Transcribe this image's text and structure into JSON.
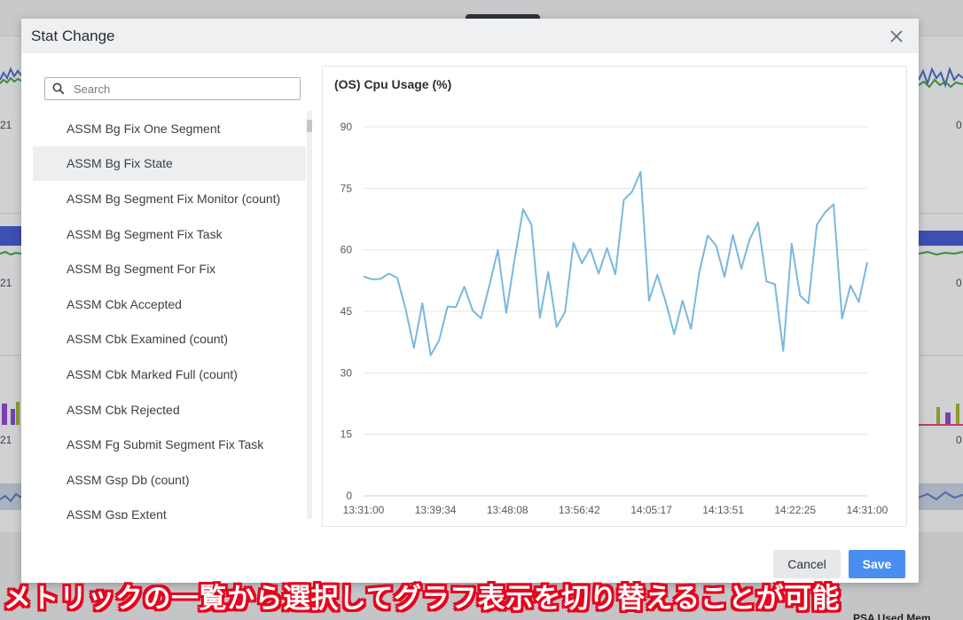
{
  "background": {
    "left_labels": [
      "21",
      "21",
      "21"
    ],
    "right_labels": [
      "0",
      "0",
      "0"
    ],
    "bottom_text": "PSA Used Mem"
  },
  "modal": {
    "title": "Stat Change",
    "close_icon": "close-icon"
  },
  "search": {
    "placeholder": "Search",
    "value": ""
  },
  "stat_list": {
    "selected_index": 1,
    "items": [
      "ASSM Bg Fix One Segment",
      "ASSM Bg Fix State",
      "ASSM Bg Segment Fix Monitor (count)",
      "ASSM Bg Segment Fix Task",
      "ASSM Bg Segment For Fix",
      "ASSM Cbk Accepted",
      "ASSM Cbk Examined (count)",
      "ASSM Cbk Marked Full (count)",
      "ASSM Cbk Rejected",
      "ASSM Fg Submit Segment Fix Task",
      "ASSM Gsp Db (count)",
      "ASSM Gsp Extent"
    ]
  },
  "buttons": {
    "cancel": "Cancel",
    "save": "Save"
  },
  "caption": "メトリックの一覧から選択してグラフ表示を切り替えることが可能",
  "colors": {
    "line": "#7ab8dc",
    "save_button": "#4a8ef0",
    "caption_outline": "#e8001c"
  },
  "chart_data": {
    "type": "line",
    "title": "(OS) Cpu Usage (%)",
    "xlabel": "",
    "ylabel": "",
    "ylim": [
      0,
      90
    ],
    "yticks": [
      0,
      15,
      30,
      45,
      60,
      75,
      90
    ],
    "xlim": [
      "13:31:00",
      "14:31:00"
    ],
    "xticks": [
      "13:31:00",
      "13:39:34",
      "13:48:08",
      "13:56:42",
      "14:05:17",
      "14:13:51",
      "14:22:25",
      "14:31:00"
    ],
    "grid": true,
    "legend": "none",
    "series": [
      {
        "name": "",
        "color": "#7ab8dc",
        "x": [
          "13:31:00",
          "13:32:00",
          "13:33:00",
          "13:34:00",
          "13:35:00",
          "13:36:00",
          "13:37:00",
          "13:38:00",
          "13:39:00",
          "13:40:00",
          "13:41:00",
          "13:42:00",
          "13:43:00",
          "13:44:00",
          "13:45:00",
          "13:46:00",
          "13:47:00",
          "13:48:00",
          "13:49:00",
          "13:50:00",
          "13:51:00",
          "13:52:00",
          "13:53:00",
          "13:54:00",
          "13:55:00",
          "13:56:00",
          "13:57:00",
          "13:58:00",
          "13:59:00",
          "14:00:00",
          "14:01:00",
          "14:02:00",
          "14:03:00",
          "14:04:00",
          "14:05:00",
          "14:06:00",
          "14:07:00",
          "14:08:00",
          "14:09:00",
          "14:10:00",
          "14:11:00",
          "14:12:00",
          "14:13:00",
          "14:14:00",
          "14:15:00",
          "14:16:00",
          "14:17:00",
          "14:18:00",
          "14:19:00",
          "14:20:00",
          "14:21:00",
          "14:22:00",
          "14:23:00",
          "14:24:00",
          "14:25:00",
          "14:26:00",
          "14:27:00",
          "14:28:00",
          "14:29:00",
          "14:30:00",
          "14:31:00"
        ],
        "values": [
          53.5,
          52.8,
          52.9,
          54.2,
          53.2,
          45.7,
          36.1,
          47.0,
          34.3,
          37.9,
          46.2,
          46.0,
          51.0,
          45.2,
          43.3,
          51.4,
          60.0,
          44.6,
          57.8,
          69.9,
          66.1,
          43.4,
          54.6,
          41.2,
          44.8,
          61.7,
          56.7,
          60.3,
          54.2,
          60.4,
          54.0,
          72.2,
          74.2,
          79.0,
          47.6,
          53.9,
          47.3,
          39.4,
          47.6,
          40.7,
          54.6,
          63.5,
          61.0,
          53.4,
          63.6,
          55.4,
          62.6,
          66.7,
          52.3,
          51.6,
          35.3,
          61.5,
          48.8,
          46.9,
          66.1,
          69.2,
          71.1,
          43.2,
          51.3,
          47.3,
          57.0
        ]
      }
    ]
  }
}
